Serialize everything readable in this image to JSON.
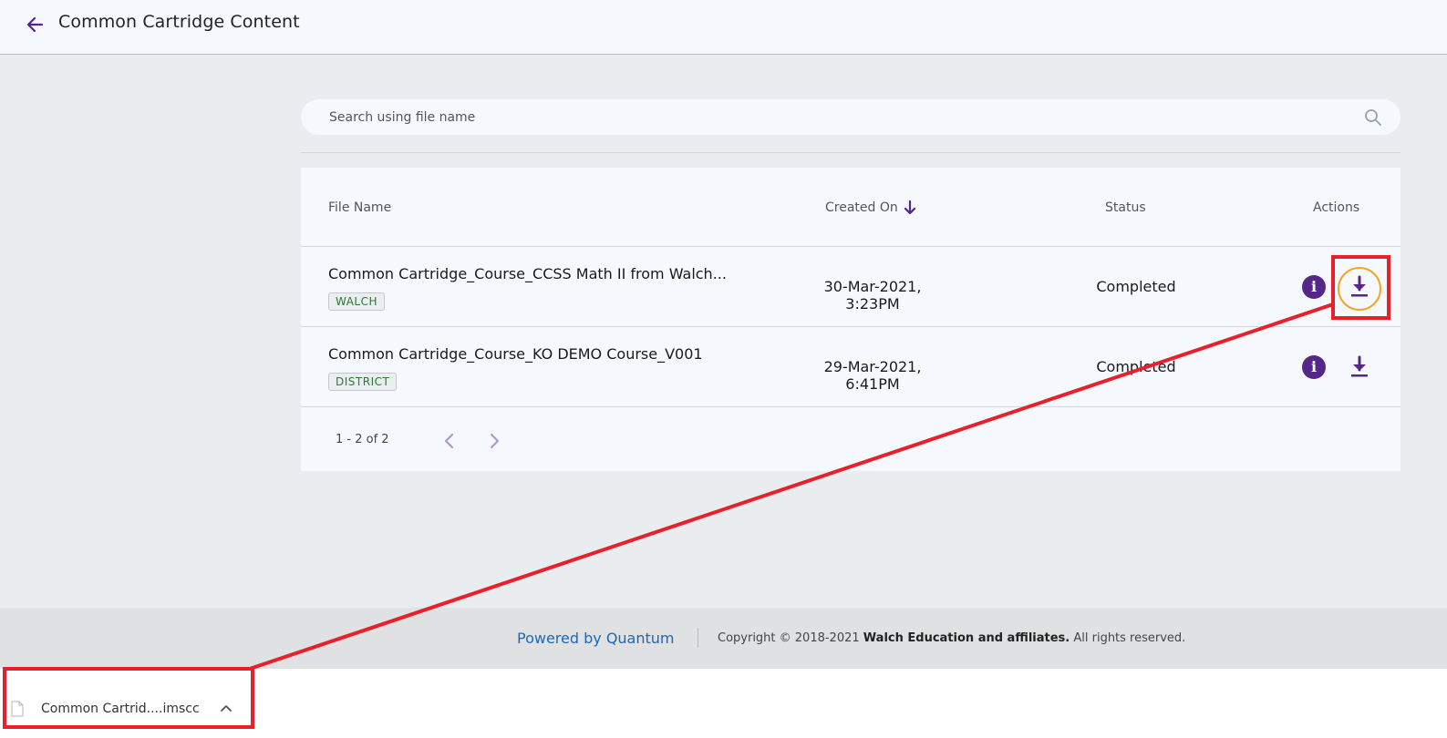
{
  "header": {
    "title": "Common Cartridge Content",
    "back_icon": "arrow-left-icon"
  },
  "search": {
    "placeholder": "Search using file name",
    "value": "",
    "icon": "search-icon"
  },
  "table": {
    "columns": {
      "file_name": "File Name",
      "created_on": "Created On",
      "status": "Status",
      "actions": "Actions"
    },
    "sort": {
      "column": "Created On",
      "direction": "descending",
      "icon": "arrow-down-icon"
    },
    "rows": [
      {
        "file_name": "Common Cartridge_Course_CCSS Math II from Walch...",
        "tag": "WALCH",
        "created_on": "30-Mar-2021, 3:23PM",
        "status": "Completed"
      },
      {
        "file_name": "Common Cartridge_Course_KO DEMO Course_V001",
        "tag": "DISTRICT",
        "created_on": "29-Mar-2021, 6:41PM",
        "status": "Completed"
      }
    ],
    "pagination": {
      "text": "1 - 2 of 2"
    }
  },
  "footer": {
    "powered_by": "Powered by Quantum",
    "copyright_prefix": "Copyright © 2018-2021",
    "copyright_company": "Walch Education and affiliates.",
    "copyright_suffix": "All rights reserved."
  },
  "download_bar": {
    "file_name": "Common Cartrid....imscc",
    "icon": "file-icon"
  },
  "colors": {
    "accent_purple": "#55278a",
    "tag_green": "#2d7a2d",
    "link_blue": "#1d68b5",
    "highlight_orange": "#f0a723",
    "annotation_red": "#e8202a"
  }
}
